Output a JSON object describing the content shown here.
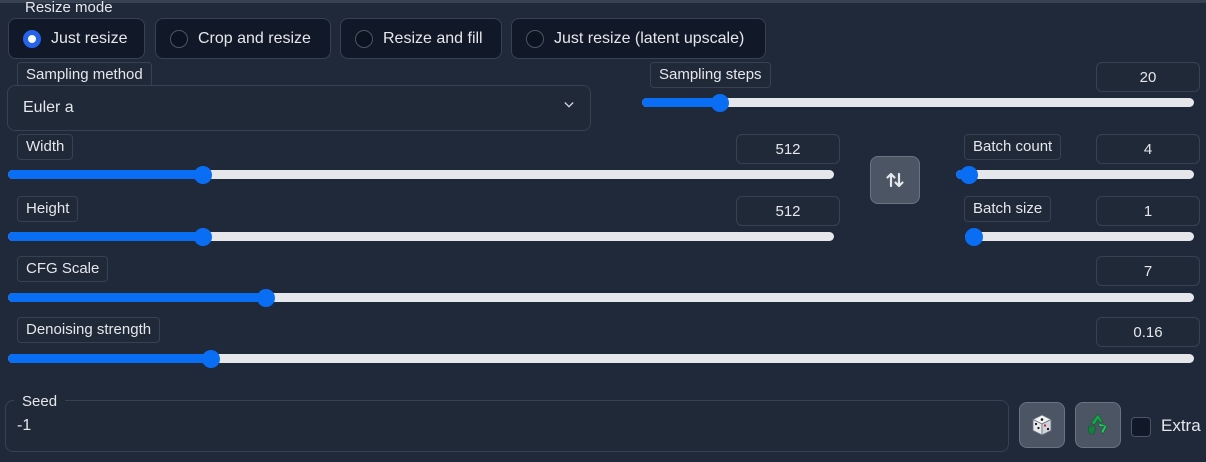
{
  "resize_mode": {
    "label": "Resize mode",
    "options": [
      {
        "label": "Just resize",
        "checked": true
      },
      {
        "label": "Crop and resize",
        "checked": false
      },
      {
        "label": "Resize and fill",
        "checked": false
      },
      {
        "label": "Just resize (latent upscale)",
        "checked": false
      }
    ]
  },
  "sampling_method": {
    "label": "Sampling method",
    "value": "Euler a"
  },
  "sampling_steps": {
    "label": "Sampling steps",
    "value": "20",
    "fraction": 0.13
  },
  "width": {
    "label": "Width",
    "value": "512",
    "fraction": 0.23
  },
  "height": {
    "label": "Height",
    "value": "512",
    "fraction": 0.23
  },
  "batch_count": {
    "label": "Batch count",
    "value": "4",
    "fraction": 0.02
  },
  "batch_size": {
    "label": "Batch size",
    "value": "1",
    "fraction": 0.0
  },
  "cfg_scale": {
    "label": "CFG Scale",
    "value": "7",
    "fraction": 0.213
  },
  "denoising_strength": {
    "label": "Denoising strength",
    "value": "0.16",
    "fraction": 0.166
  },
  "seed": {
    "label": "Seed",
    "value": "-1"
  },
  "extra": {
    "label": "Extra",
    "checked": false
  },
  "colors": {
    "accent": "#0a6ef5",
    "track": "#e5e7eb",
    "background": "#202939"
  },
  "icons": {
    "swap": "swap-icon",
    "dice": "dice-icon",
    "recycle": "recycle-icon"
  }
}
